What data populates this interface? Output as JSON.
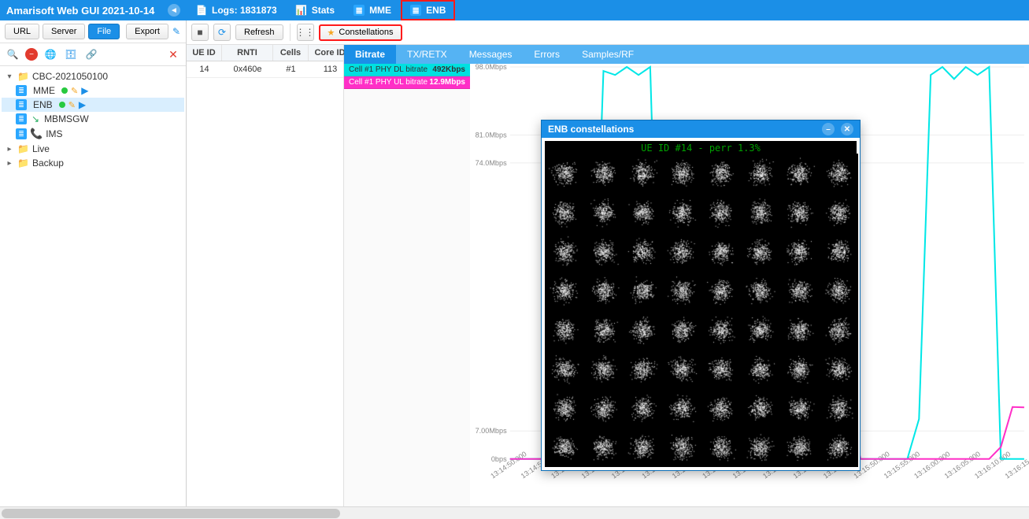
{
  "header": {
    "title": "Amarisoft Web GUI 2021-10-14",
    "tabs": {
      "logs": "Logs: 1831873",
      "stats": "Stats",
      "mme": "MME",
      "enb": "ENB"
    }
  },
  "left_toolbar": {
    "url": "URL",
    "server": "Server",
    "file": "File",
    "export": "Export"
  },
  "tree": {
    "root": "CBC-2021050100",
    "nodes": {
      "mme": "MME",
      "enb": "ENB",
      "mbmsgw": "MBMSGW",
      "ims": "IMS",
      "live": "Live",
      "backup": "Backup"
    }
  },
  "right_toolbar": {
    "refresh": "Refresh",
    "constellations": "Constellations"
  },
  "ue_table": {
    "headers": {
      "ue_id": "UE ID",
      "rnti": "RNTI",
      "cells": "Cells",
      "core_id": "Core ID"
    },
    "row": {
      "ue_id": "14",
      "rnti": "0x460e",
      "cells": "#1",
      "core_id": "113"
    }
  },
  "sub_tabs": {
    "bitrate": "Bitrate",
    "tx": "TX/RETX",
    "messages": "Messages",
    "errors": "Errors",
    "samples": "Samples/RF"
  },
  "legend": {
    "dl_name": "Cell #1 PHY DL bitrate",
    "dl_val": "492Kbps",
    "ul_name": "Cell #1 PHY UL bitrate",
    "ul_val": "12.9Mbps"
  },
  "chart_data": {
    "type": "line",
    "ylabel": "bitrate",
    "ylim": [
      0,
      98
    ],
    "y_ticks": [
      0,
      7,
      74,
      81,
      98
    ],
    "y_tick_labels": [
      "0bps",
      "7.00Mbps",
      "74.0Mbps",
      "81.0Mbps",
      "98.0Mbps"
    ],
    "x_ticks": [
      "13:14:50.000",
      "13:14:55.000",
      "13:15:00.000",
      "13:15:05.000",
      "13:15:10.000",
      "13:15:15.000",
      "13:15:20.000",
      "13:15:25.000",
      "13:15:30.000",
      "13:15:35.000",
      "13:15:40.000",
      "13:15:45.000",
      "13:15:50.000",
      "13:15:55.000",
      "13:16:00.000",
      "13:16:05.000",
      "13:16:10.000",
      "13:16:15.000"
    ],
    "series": [
      {
        "name": "DL",
        "color": "#00e7e7",
        "values": [
          0,
          0,
          0,
          0,
          0,
          0,
          0,
          14,
          97,
          96,
          98,
          96,
          98,
          0,
          0,
          0,
          0,
          0,
          0,
          0,
          0,
          0,
          0,
          0,
          0,
          0,
          0,
          0,
          0,
          0,
          0,
          0,
          0,
          0,
          0,
          10,
          96,
          98,
          95,
          98,
          96,
          98,
          0,
          0,
          0
        ]
      },
      {
        "name": "UL",
        "color": "#ff2fc7",
        "values": [
          0,
          0,
          0,
          0,
          0,
          0,
          0,
          0,
          0,
          0,
          0,
          0,
          0,
          0,
          0,
          0,
          0,
          0,
          0,
          0,
          0,
          0,
          0,
          0,
          2,
          13,
          12.5,
          13,
          12.8,
          13,
          0,
          0,
          0,
          0,
          0,
          0,
          0,
          0,
          0,
          0,
          0,
          0,
          3,
          13,
          12.9
        ]
      }
    ]
  },
  "modal": {
    "title": "ENB constellations",
    "subtitle": "UE ID #14 - perr 1.3%"
  }
}
